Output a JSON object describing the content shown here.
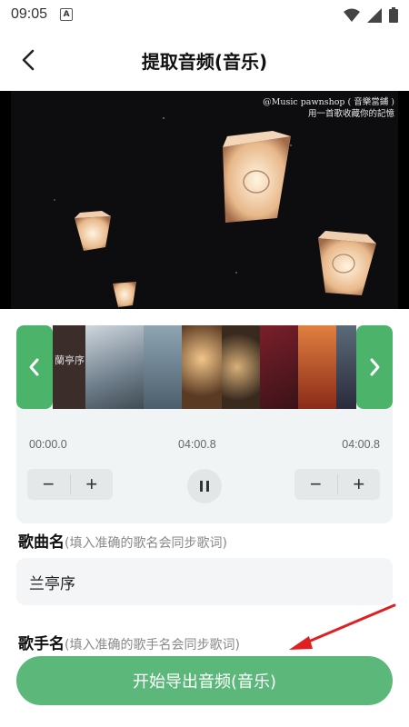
{
  "status_bar": {
    "time": "09:05",
    "notification_icon": "a-letter-icon",
    "icons": [
      "wifi-icon",
      "signal-icon",
      "battery-icon"
    ]
  },
  "nav": {
    "title": "提取音频(音乐)",
    "back_icon": "chevron-left-icon"
  },
  "video": {
    "caption_line1": "@Music pawnshop ( 音樂當鋪 )",
    "caption_line2": "用一首歌收藏你的記憶"
  },
  "editor": {
    "thumbnail_text": "蘭亭序",
    "start_time": "00:00.0",
    "current_time": "04:00.8",
    "end_time": "04:00.8",
    "minus_label": "−",
    "plus_label": "+"
  },
  "song_name": {
    "label": "歌曲名",
    "hint": "(填入准确的歌名会同步歌词)",
    "value": "兰亭序"
  },
  "singer_name": {
    "label": "歌手名",
    "hint": "(填入准确的歌手名会同步歌词)"
  },
  "export_button": {
    "label": "开始导出音频(音乐)"
  },
  "colors": {
    "accent": "#5cb87a",
    "handle": "#4cb46a",
    "annotation_arrow": "#e02020"
  }
}
